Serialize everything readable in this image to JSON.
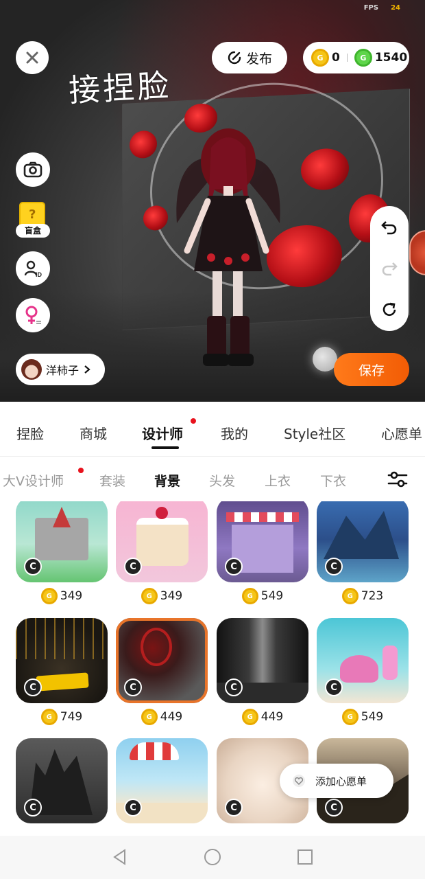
{
  "status": {
    "fps_label": "FPS",
    "fps_value": "24"
  },
  "top_bar": {
    "publish_label": "发布",
    "gold_coins": "0",
    "green_coins": "1540"
  },
  "stage": {
    "title_text": "接捏脸",
    "blindbox_label": "盲盒",
    "author_name": "洋柿子",
    "save_label": "保存"
  },
  "tabs": [
    {
      "label": "捏脸"
    },
    {
      "label": "商城"
    },
    {
      "label": "设计师"
    },
    {
      "label": "我的"
    },
    {
      "label": "Style社区"
    },
    {
      "label": "心愿单"
    }
  ],
  "subtabs": [
    {
      "label": "大V设计师"
    },
    {
      "label": "套装"
    },
    {
      "label": "背景"
    },
    {
      "label": "头发"
    },
    {
      "label": "上衣"
    },
    {
      "label": "下衣"
    }
  ],
  "items": [
    {
      "price": "349",
      "theme": "castle"
    },
    {
      "price": "349",
      "theme": "cake"
    },
    {
      "price": "549",
      "theme": "shop"
    },
    {
      "price": "723",
      "theme": "ocean-cliff"
    },
    {
      "price": "749",
      "theme": "dark-gold"
    },
    {
      "price": "449",
      "theme": "red-eye"
    },
    {
      "price": "449",
      "theme": "spotlight"
    },
    {
      "price": "549",
      "theme": "seabed"
    },
    {
      "price": "",
      "theme": "gothic"
    },
    {
      "price": "",
      "theme": "beach"
    },
    {
      "price": "",
      "theme": "fur"
    },
    {
      "price": "",
      "theme": "ruins"
    }
  ],
  "wishlist_popup": {
    "label": "添加心愿单"
  },
  "colors": {
    "accent": "#f25c05",
    "red_dot": "#e8121d",
    "selected_border": "#e8742a"
  }
}
